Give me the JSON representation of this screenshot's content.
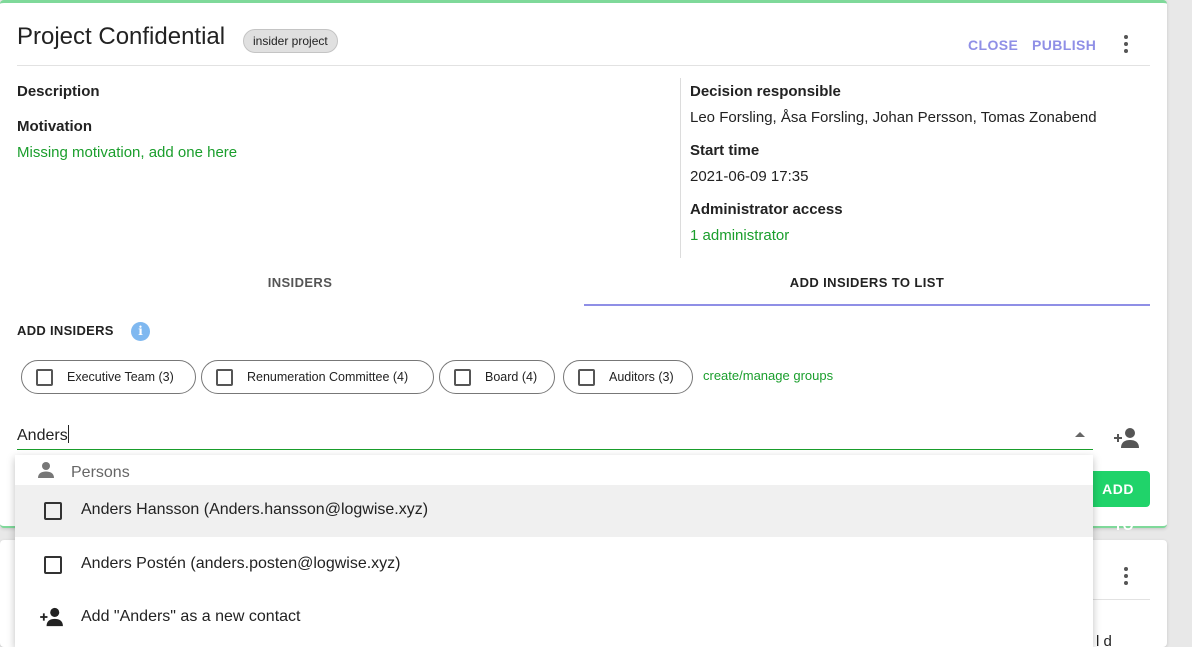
{
  "header": {
    "title": "Project Confidential",
    "badge": "insider project",
    "close_label": "CLOSE",
    "publish_label": "PUBLISH",
    "more_icon": "more-vert-icon"
  },
  "details": {
    "description_label": "Description",
    "motivation_label": "Motivation",
    "motivation_missing": "Missing motivation, add one here",
    "decision_label": "Decision responsible",
    "decision_value": "Leo Forsling, Åsa Forsling, Johan Persson, Tomas Zonabend",
    "start_label": "Start time",
    "start_value": "2021-06-09 17:35",
    "admin_label": "Administrator access",
    "admin_value": "1 administrator"
  },
  "tabs": [
    {
      "label": "INSIDERS",
      "active": false
    },
    {
      "label": "ADD INSIDERS TO LIST",
      "active": true
    }
  ],
  "add_insiders": {
    "title": "ADD INSIDERS",
    "info_icon": "i",
    "groups": [
      {
        "label": "Executive Team (3)",
        "checked": false
      },
      {
        "label": "Renumeration Committee (4)",
        "checked": false
      },
      {
        "label": "Board (4)",
        "checked": false
      },
      {
        "label": "Auditors (3)",
        "checked": false
      }
    ],
    "manage_link": "create/manage groups",
    "search_value": "Anders",
    "add_button_label": "ADD TO LIST"
  },
  "dropdown": {
    "header": "Persons",
    "options": [
      {
        "label": "Anders Hansson (Anders.hansson@logwise.xyz)",
        "checked": false
      },
      {
        "label": "Anders Postén (anders.posten@logwise.xyz)",
        "checked": false
      }
    ],
    "add_contact": "Add \"Anders\" as a new contact"
  },
  "colors": {
    "accent": "#8f8fe6",
    "link_green": "#1a9e2c",
    "button_green": "#20d36a",
    "card_border": "#7fd99a"
  },
  "card2": {
    "partial_text": "l     d"
  }
}
